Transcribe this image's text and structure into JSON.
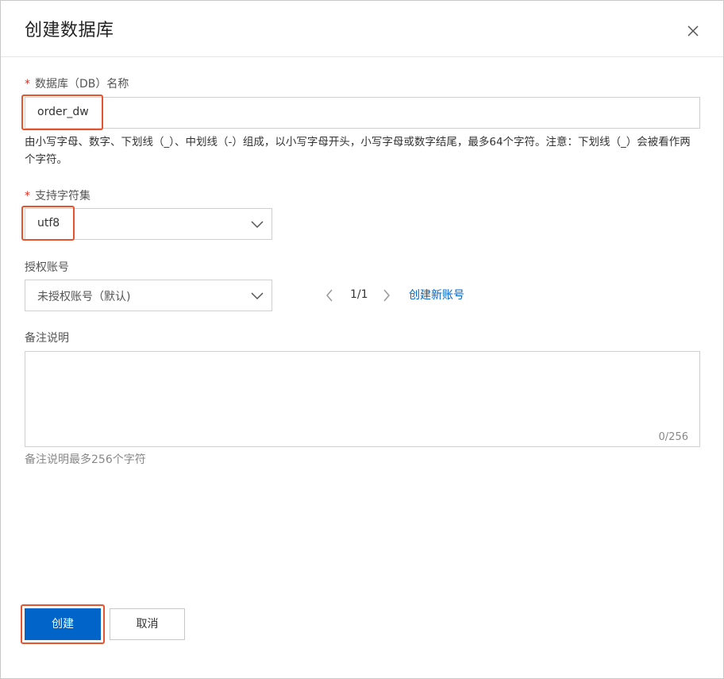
{
  "dialog": {
    "title": "创建数据库",
    "close_icon": "close-icon"
  },
  "form": {
    "db_name": {
      "required_mark": "*",
      "label": "数据库（DB）名称",
      "value": "order_dw",
      "hint": "由小写字母、数字、下划线（_）、中划线（-）组成，以小写字母开头，小写字母或数字结尾，最多64个字符。注意：下划线（_）会被看作两个字符。"
    },
    "charset": {
      "required_mark": "*",
      "label": "支持字符集",
      "value": "utf8",
      "icon": "chevron-down-icon"
    },
    "account": {
      "label": "授权账号",
      "value": "未授权账号（默认)",
      "icon": "chevron-down-icon",
      "pager": {
        "prev_icon": "chevron-left-icon",
        "page": "1/1",
        "next_icon": "chevron-right-icon"
      },
      "create_link": "创建新账号"
    },
    "remark": {
      "label": "备注说明",
      "value": "",
      "counter": "0/256",
      "hint": "备注说明最多256个字符"
    }
  },
  "footer": {
    "create_label": "创建",
    "cancel_label": "取消"
  },
  "colors": {
    "primary": "#0064c8",
    "highlight": "#e5532f",
    "required": "#d93026"
  }
}
